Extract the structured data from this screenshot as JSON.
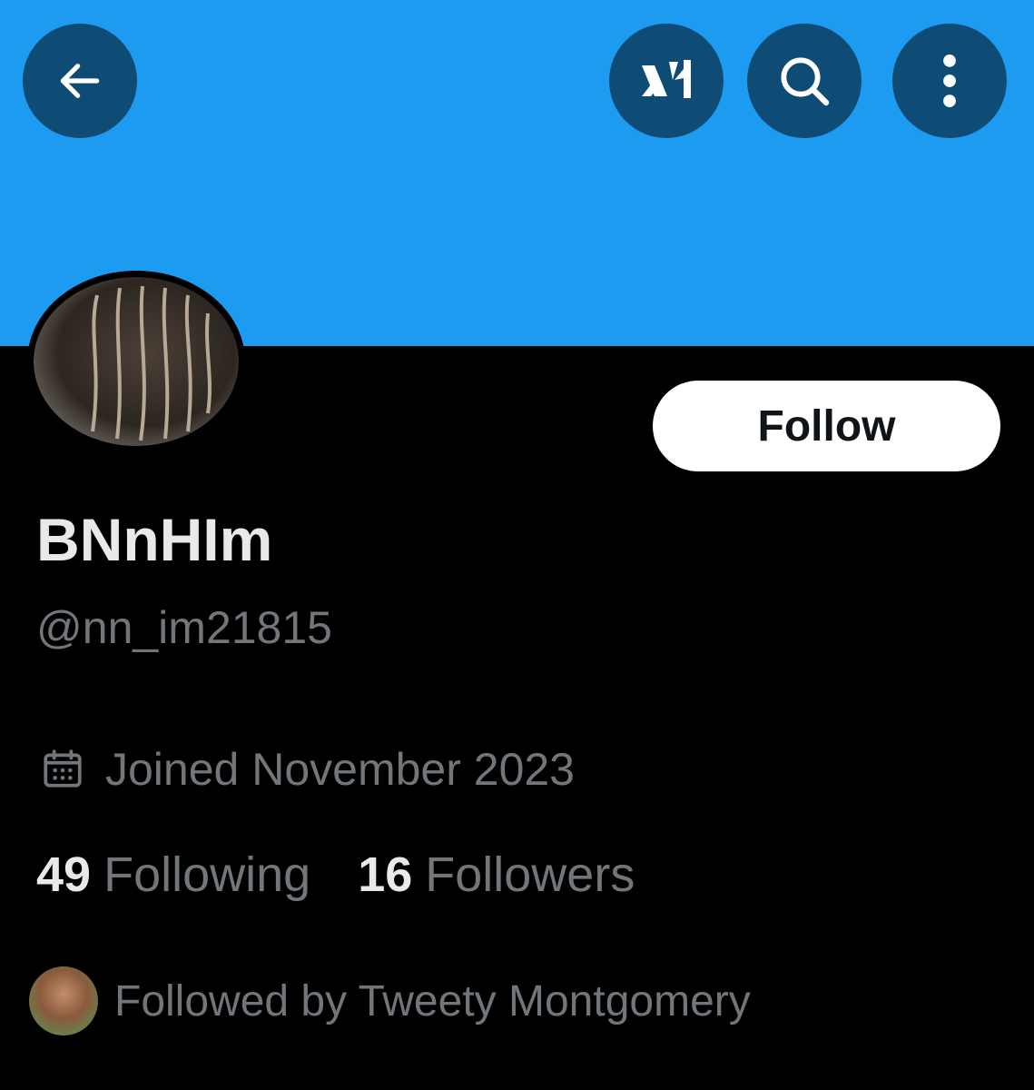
{
  "header": {
    "back_icon": "arrow-left-icon",
    "grok_icon": "grok-icon",
    "search_icon": "search-icon",
    "more_icon": "more-vertical-icon",
    "banner_color": "#1d9bf0",
    "button_color": "#0f4c75"
  },
  "profile": {
    "display_name": "BNnHIm",
    "handle": "@nn_im21815",
    "follow_label": "Follow",
    "joined_icon": "calendar-icon",
    "joined": "Joined November 2023",
    "following_count": "49",
    "following_label": "Following",
    "followers_count": "16",
    "followers_label": "Followers",
    "followed_by": "Followed by Tweety Montgomery"
  }
}
